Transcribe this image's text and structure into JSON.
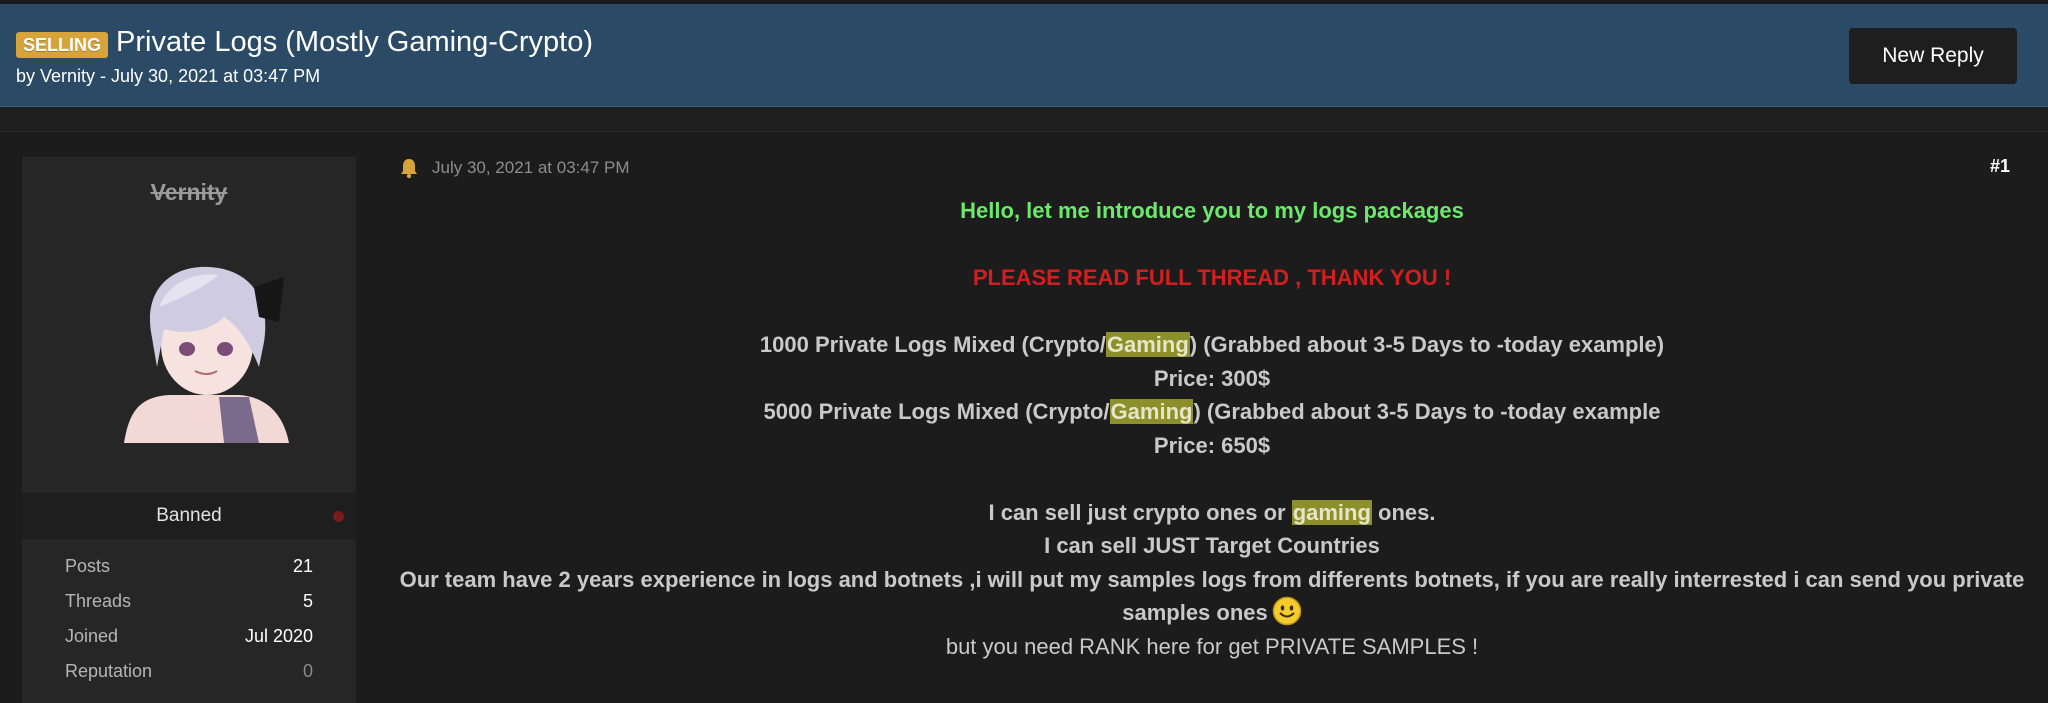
{
  "thread": {
    "prefix": "SELLING",
    "title": "Private Logs (Mostly Gaming-Crypto)",
    "meta": "by Vernity - July 30, 2021 at 03:47 PM",
    "new_reply_label": "New Reply"
  },
  "user": {
    "name": "Vernity",
    "rank": "Banned",
    "stats": [
      {
        "label": "Posts",
        "value": "21"
      },
      {
        "label": "Threads",
        "value": "5"
      },
      {
        "label": "Joined",
        "value": "Jul 2020"
      },
      {
        "label": "Reputation",
        "value": "0"
      }
    ]
  },
  "post": {
    "date": "July 30, 2021 at 03:47 PM",
    "number": "#1",
    "intro": "Hello, let me introduce you to my logs packages",
    "warning": "PLEASE READ FULL THREAD , THANK YOU !",
    "pkg1_a": "1000 Private Logs Mixed (Crypto/",
    "pkg1_hl": "Gaming",
    "pkg1_b": ") (Grabbed about 3-5 Days to -today example)",
    "price1": "Price: 300$",
    "pkg2_a": "5000 Private Logs Mixed (Crypto/",
    "pkg2_hl": "Gaming",
    "pkg2_b": ") (Grabbed about 3-5 Days to -today example",
    "price2": "Price: 650$",
    "line_sell_a": "I can sell just crypto ones or ",
    "line_sell_hl": "gaming",
    "line_sell_b": " ones.",
    "line_target": "I can sell JUST Target Countries",
    "line_team": "Our team have 2 years experience in logs and botnets ,i will put my samples logs from differents botnets, if you are really interrested i can send you private samples ones",
    "line_rank": "but you need RANK here for get PRIVATE SAMPLES !"
  },
  "colors": {
    "header_bg": "#2a4a66",
    "prefix_badge": "#d6a43a",
    "intro_green": "#6de86d",
    "warning_red": "#d21e1e",
    "highlight": "#8d8f2a"
  },
  "icons": {
    "bell": "bell-icon",
    "smiley": "smiley-icon",
    "status": "status-dot"
  }
}
